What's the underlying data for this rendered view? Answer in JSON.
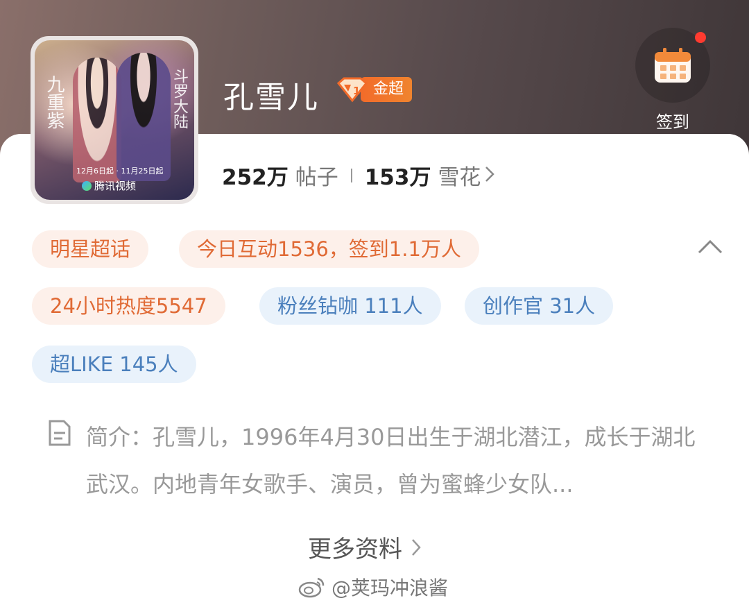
{
  "profile": {
    "name": "孔雪儿",
    "badge_label": "金超",
    "posts_count": "252万",
    "posts_unit": "帖子",
    "fans_count": "153万",
    "fans_unit": "雪花"
  },
  "cover": {
    "title_left": "九重紫",
    "title_right": "斗罗大陆",
    "dates": "12月6日起 · 11月25日起",
    "brand": "腾讯视频"
  },
  "checkin": {
    "label": "签到",
    "icon": "calendar-icon"
  },
  "tags": {
    "star_topic": "明星超话",
    "today": "今日互动1536，签到1.1万人",
    "heat": "24小时热度5547",
    "fan_diamond": "粉丝钻咖 111人",
    "creator": "创作官 31人",
    "super_like": "超LIKE 145人"
  },
  "intro": {
    "text": "简介：孔雪儿，1996年4月30日出生于湖北潜江，成长于湖北武汉。内地青年女歌手、演员，曾为蜜蜂少女队..."
  },
  "more": {
    "label": "更多资料"
  },
  "watermark": {
    "text": "@荚玛冲浪酱"
  },
  "colors": {
    "accent_orange": "#e06a35",
    "accent_blue": "#4a7fbc",
    "badge": "#f26b2a"
  }
}
